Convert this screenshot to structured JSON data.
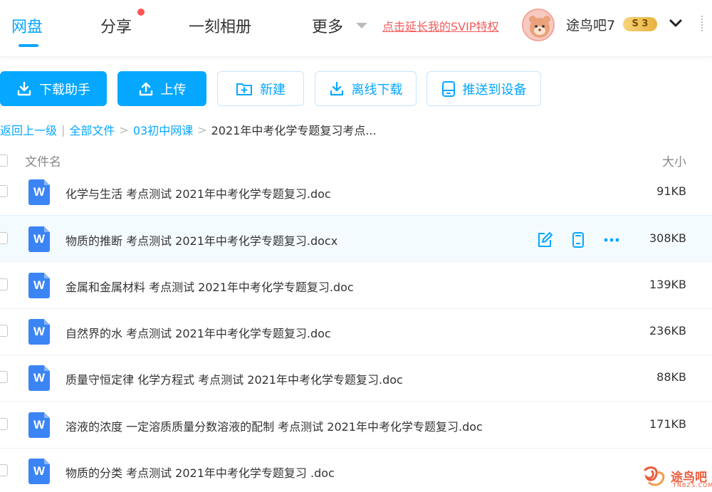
{
  "nav": {
    "tabs": [
      {
        "label": "网盘",
        "active": true
      },
      {
        "label": "分享",
        "active": false,
        "has_dot": true
      },
      {
        "label": "一刻相册",
        "active": false
      },
      {
        "label": "更多",
        "active": false
      }
    ],
    "svip_link": "点击延长我的SVIP特权",
    "username": "途鸟吧7",
    "level_badge": "S 3"
  },
  "toolbar": {
    "download_helper": "下载助手",
    "upload": "上传",
    "new": "新建",
    "offline_download": "离线下载",
    "push_to_device": "推送到设备"
  },
  "breadcrumb": {
    "back": "返回上一级",
    "divider": "|",
    "all_files": "全部文件",
    "folder": "03初中网课",
    "current": "2021年中考化学专题复习考点..."
  },
  "table": {
    "col_name": "文件名",
    "col_size": "大小",
    "rows": [
      {
        "name": "化学与生活 考点测试 2021年中考化学专题复习.doc",
        "size": "91KB",
        "icon": "W"
      },
      {
        "name": "物质的推断 考点测试 2021年中考化学专题复习.docx",
        "size": "308KB",
        "icon": "W",
        "hovered": true
      },
      {
        "name": "金属和金属材料 考点测试 2021年中考化学专题复习.doc",
        "size": "139KB",
        "icon": "W"
      },
      {
        "name": "自然界的水 考点测试 2021年中考化学专题复习.doc",
        "size": "236KB",
        "icon": "W"
      },
      {
        "name": "质量守恒定律 化学方程式 考点测试 2021年中考化学专题复习.doc",
        "size": "88KB",
        "icon": "W"
      },
      {
        "name": "溶液的浓度 一定溶质质量分数溶液的配制 考点测试 2021年中考化学专题复习.doc",
        "size": "171KB",
        "icon": "W"
      },
      {
        "name": "物质的分类 考点测试 2021年中考化学专题复习 .doc",
        "size": "",
        "icon": "W"
      }
    ]
  },
  "watermark": {
    "text": "途鸟吧",
    "sub": "TNBZS.COM"
  },
  "colors": {
    "accent": "#06a7ff",
    "svip": "#f25d5d",
    "word_icon": "#3b84f4"
  }
}
